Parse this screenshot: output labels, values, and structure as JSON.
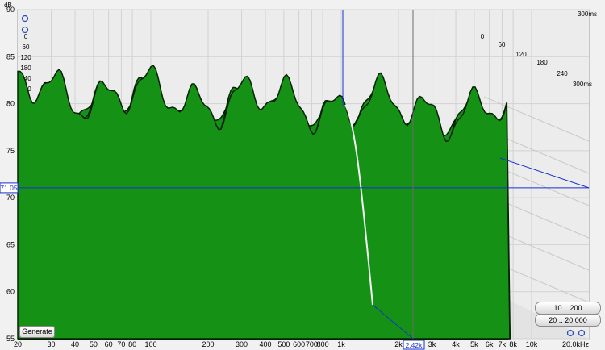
{
  "chart_data": {
    "type": "waterfall",
    "y_unit": "dB",
    "ylim": [
      55,
      90
    ],
    "y_ticks": [
      "90",
      "85",
      "80",
      "75",
      "70",
      "65",
      "60",
      "55"
    ],
    "x_unit": "kHz",
    "xlim": [
      20,
      20000
    ],
    "x_ticks": [
      "20",
      "30",
      "40",
      "50",
      "60",
      "70",
      "80",
      "100",
      "200",
      "300",
      "400",
      "500",
      "600",
      "700",
      "800",
      "1k",
      "2k",
      "3k",
      "4k",
      "5k",
      "6k",
      "7k",
      "8k",
      "10k",
      "20.0kHz"
    ],
    "time_unit": "ms",
    "time_ticks": [
      "0",
      "60",
      "120",
      "180",
      "240",
      "300ms"
    ],
    "left_time_labels": [
      "0",
      "60",
      "120",
      "180",
      "240",
      "300"
    ],
    "cursor": {
      "level_label": "71.05",
      "freq_label": "2.42k"
    },
    "slices": 32,
    "first_slice_peak_db": 80
  },
  "controls": {
    "generate_label": "Generate",
    "range_button_1": "10 .. 200",
    "range_button_2": "20 .. 20,000"
  },
  "colors": {
    "fill": "#159215",
    "ridge": "#062206",
    "cursor": "#1a2fd0"
  }
}
